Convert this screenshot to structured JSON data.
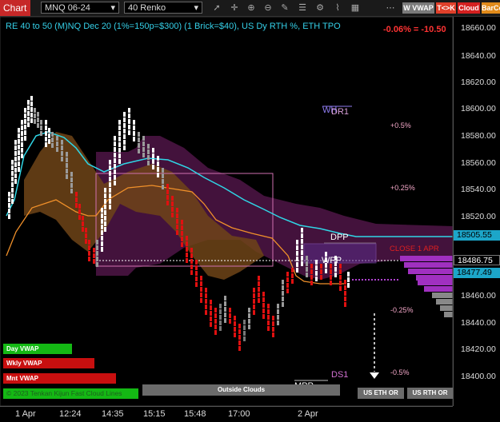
{
  "toolbar": {
    "chart_tab": "Chart",
    "instrument": "MNQ 06-24",
    "bar_type": "40 Renko",
    "w_vwap": "W VWAP",
    "tck": "T<>K",
    "cloud": "Cloud",
    "barco": "BarCo",
    "icons": [
      "pointer-icon",
      "crosshair-icon",
      "zoom-in-icon",
      "zoom-out-icon",
      "drawing-icon",
      "properties-icon",
      "strategies-icon",
      "indicators-icon",
      "templates-icon"
    ]
  },
  "chart": {
    "title": "RE 40 to 50 (M)NQ Dec 20 (1%=150p=$300) (1 Brick=$40), US Dy RTH %, ETH TPO",
    "pnl": "-0.06% = -10.50",
    "price_ticks": [
      "18660.00",
      "18640.00",
      "18620.00",
      "18600.00",
      "18580.00",
      "18560.00",
      "18540.00",
      "18520.00",
      "18460.00",
      "18440.00",
      "18420.00",
      "18400.00"
    ],
    "price_tags": [
      {
        "value": "18505.55",
        "bg": "#1ca6c9",
        "fg": "#000000"
      },
      {
        "value": "18486.75",
        "bg": "#000000",
        "fg": "#ffffff"
      },
      {
        "value": "18477.49",
        "bg": "#1ca6c9",
        "fg": "#000000"
      }
    ],
    "time_labels": [
      "1 Apr",
      "12:24",
      "14:35",
      "15:15",
      "15:48",
      "17:00",
      "2 Apr"
    ],
    "levels": {
      "wh": "WH",
      "dr1": "DR1",
      "dpp": "DPP",
      "wpp": "WPP",
      "ds1": "DS1",
      "mpp": "MPP",
      "close": "CLOSE 1 APR"
    },
    "pct_labels": [
      "+0.5%",
      "+0.25%",
      "-0.25%",
      "-0.5%"
    ],
    "legend_buttons": [
      {
        "label": "Day VWAP",
        "color": "#14b814"
      },
      {
        "label": "Wkly VWAP",
        "color": "#c80f0f"
      },
      {
        "label": "Mnt VWAP",
        "color": "#c80f0f"
      }
    ],
    "bottom_green_label": "© 2023 Tenkan Kijun Fast Cloud Lines",
    "outside_clouds": "Outside Clouds",
    "us_eth_or": "US ETH OR",
    "us_rth_or": "US RTH OR",
    "colors": {
      "up_brick": "#ffffff",
      "up_brick_dim": "#9a9a9a",
      "down_brick": "#e01010",
      "down_brick_dim": "#777777",
      "cyan_line": "#2fd6e6",
      "orange_line": "#f0902a",
      "cloud_brown": "#6e4418",
      "cloud_purple": "#5a1850",
      "box_pink": "#d070b0"
    }
  },
  "chart_data": {
    "type": "renko",
    "brick_size": 40,
    "ylim": [
      18395,
      18665
    ],
    "bricks_close": [
      18520,
      18540,
      18560,
      18580,
      18600,
      18580,
      18600,
      18580,
      18560,
      18540,
      18520,
      18500,
      18480,
      18500,
      18520,
      18540,
      18560,
      18580,
      18600,
      18580,
      18560,
      18540,
      18520,
      18500,
      18480,
      18460,
      18440,
      18460,
      18480,
      18460,
      18440,
      18420,
      18440,
      18460,
      18480,
      18460,
      18440,
      18460,
      18480,
      18500,
      18490,
      18480,
      18460,
      18470,
      18490,
      18480,
      18470,
      18480,
      18490
    ]
  }
}
